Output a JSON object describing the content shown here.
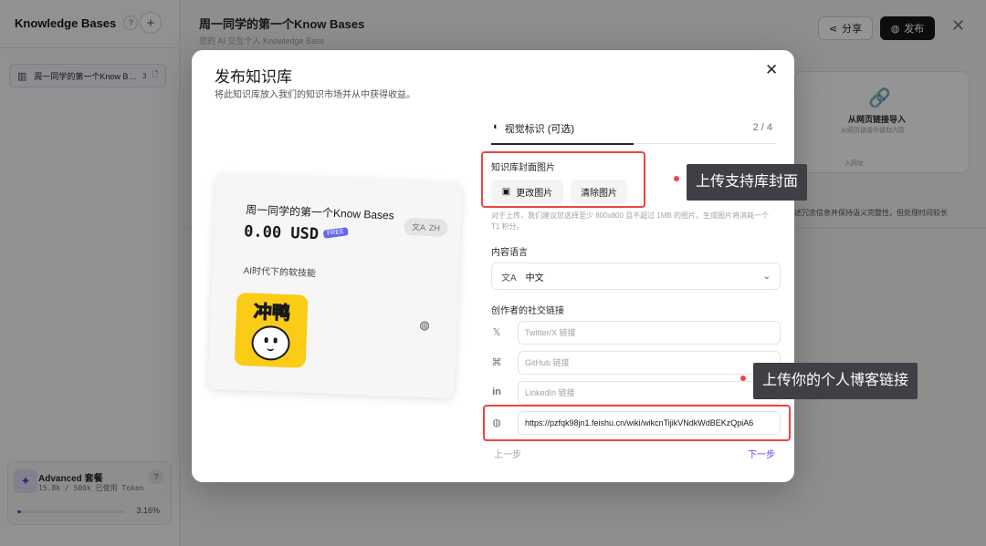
{
  "sidebar": {
    "title": "Knowledge Bases",
    "help_label": "?",
    "add_label": "+",
    "items": [
      {
        "label": "周一同学的第一个Know Bases",
        "count": "3"
      }
    ],
    "plan": {
      "name": "Advanced 套餐",
      "usage": "15.8k / 500k 已使用 Token",
      "help_label": "?",
      "progress_pct": 3.16,
      "progress_text": "3.16%"
    }
  },
  "header": {
    "title": "周一同学的第一个Know Bases",
    "subtitle": "您的 AI 交互个人 Knowledge Base",
    "share_label": "分享",
    "publish_label": "发布",
    "close_label": "✕"
  },
  "background": {
    "card_title": "从网页链接导入",
    "card_sub": "从网页链接中提取内容",
    "card_url_hint": "入网址",
    "note": "述冗余信息并保持语义完整性，但处理时间较长"
  },
  "modal": {
    "title": "发布知识库",
    "subtitle": "将此知识库放入我们的知识市场并从中获得收益。",
    "close_label": "✕",
    "preview": {
      "title": "周一同学的第一个Know Bases",
      "lang_badge": "ZH",
      "price": "0.00 USD",
      "free_badge": "FREE",
      "description": "AI时代下的软技能",
      "cover_text": "冲鸭"
    },
    "tab": {
      "label": "视觉标识 (可选)",
      "step": "2 / 4"
    },
    "cover": {
      "label": "知识库封面图片",
      "change_label": "更改图片",
      "clear_label": "清除图片",
      "hint": "对于上传，我们建议您选择至少 800x800 且不超过 1MB 的图片。生成图片将消耗一个 T1 积分。"
    },
    "language": {
      "label": "内容语言",
      "value": "中文"
    },
    "social": {
      "label": "创作者的社交链接",
      "twitter_placeholder": "Twitter/X 链接",
      "github_placeholder": "GitHub 链接",
      "linkedin_placeholder": "LinkedIn 链接",
      "website_value": "https://pzfqk98jn1.feishu.cn/wiki/wikcnTijikVNdkWdBEKzQpiA6"
    },
    "prev_label": "上一步",
    "next_label": "下一步"
  },
  "annotations": {
    "cover_callout": "上传支持库封面",
    "blog_callout": "上传你的个人博客链接",
    "accent": "#ef4444"
  }
}
